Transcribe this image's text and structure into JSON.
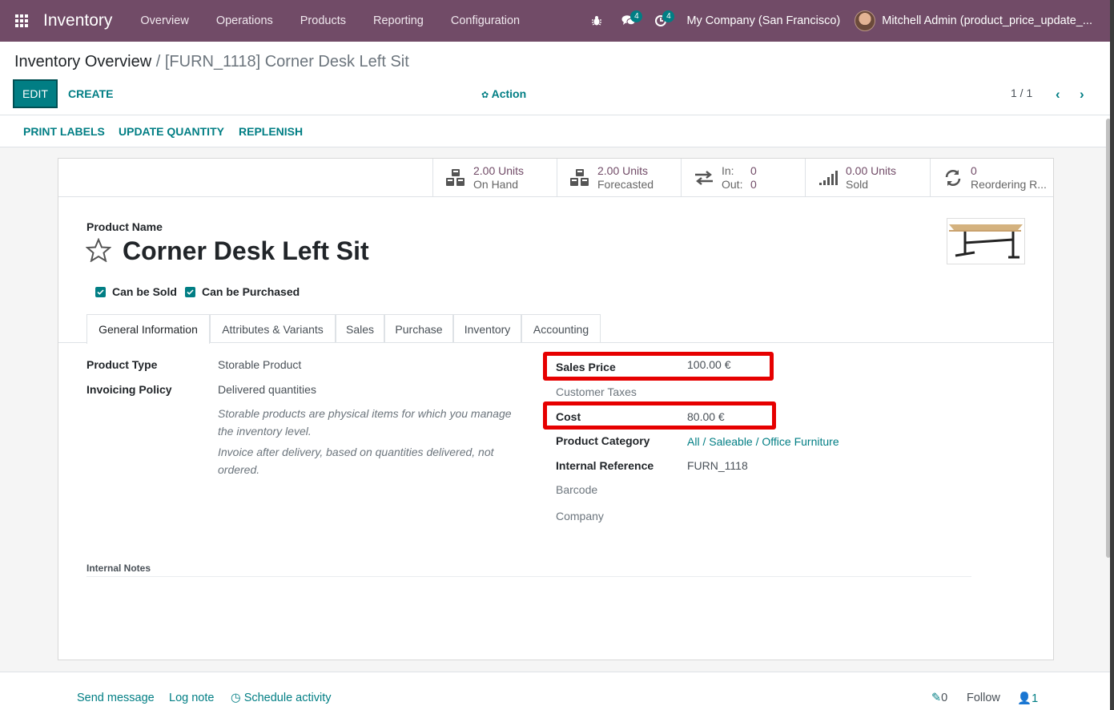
{
  "navbar": {
    "app_name": "Inventory",
    "menu": [
      "Overview",
      "Operations",
      "Products",
      "Reporting",
      "Configuration"
    ],
    "messages_badge": "4",
    "activities_badge": "4",
    "company": "My Company (San Francisco)",
    "user": "Mitchell Admin (product_price_update_..."
  },
  "control_panel": {
    "breadcrumb_parent": "Inventory Overview",
    "breadcrumb_separator": "/",
    "breadcrumb_current": "[FURN_1118] Corner Desk Left Sit",
    "edit_label": "EDIT",
    "create_label": "CREATE",
    "action_label": "Action",
    "pager": "1 / 1"
  },
  "statusbar": {
    "buttons": [
      "PRINT LABELS",
      "UPDATE QUANTITY",
      "REPLENISH"
    ]
  },
  "smart_buttons": {
    "on_hand": {
      "value": "2.00 Units",
      "label": "On Hand",
      "icon": "cubes-icon"
    },
    "forecasted": {
      "value": "2.00 Units",
      "label": "Forecasted",
      "icon": "cubes-icon"
    },
    "in_out": {
      "in_label": "In:",
      "in_value": "0",
      "out_label": "Out:",
      "out_value": "0",
      "icon": "exchange-icon"
    },
    "sold": {
      "value": "0.00 Units",
      "label": "Sold",
      "icon": "signal-icon"
    },
    "reordering": {
      "value": "0",
      "label": "Reordering R...",
      "icon": "refresh-icon"
    }
  },
  "product": {
    "name_label": "Product Name",
    "name": "Corner Desk Left Sit",
    "can_be_sold": "Can be Sold",
    "can_be_purchased": "Can be Purchased"
  },
  "tabs": [
    "General Information",
    "Attributes & Variants",
    "Sales",
    "Purchase",
    "Inventory",
    "Accounting"
  ],
  "general_info": {
    "product_type_label": "Product Type",
    "product_type": "Storable Product",
    "invoicing_policy_label": "Invoicing Policy",
    "invoicing_policy": "Delivered quantities",
    "help_storable": "Storable products are physical items for which you manage the inventory level.",
    "help_invoice": "Invoice after delivery, based on quantities delivered, not ordered.",
    "sales_price_label": "Sales Price",
    "sales_price": "100.00 €",
    "customer_taxes_label": "Customer Taxes",
    "cost_label": "Cost",
    "cost": "80.00 €",
    "category_label": "Product Category",
    "category": "All / Saleable / Office Furniture",
    "internal_ref_label": "Internal Reference",
    "internal_ref": "FURN_1118",
    "barcode_label": "Barcode",
    "company_label": "Company",
    "internal_notes_label": "Internal Notes"
  },
  "chatter": {
    "send_message": "Send message",
    "log_note": "Log note",
    "schedule_activity": "Schedule activity",
    "attachments_count": "0",
    "follow": "Follow",
    "followers_count": "1"
  },
  "colors": {
    "brand": "#714b67",
    "accent": "#017e84",
    "highlight": "#e60000"
  }
}
